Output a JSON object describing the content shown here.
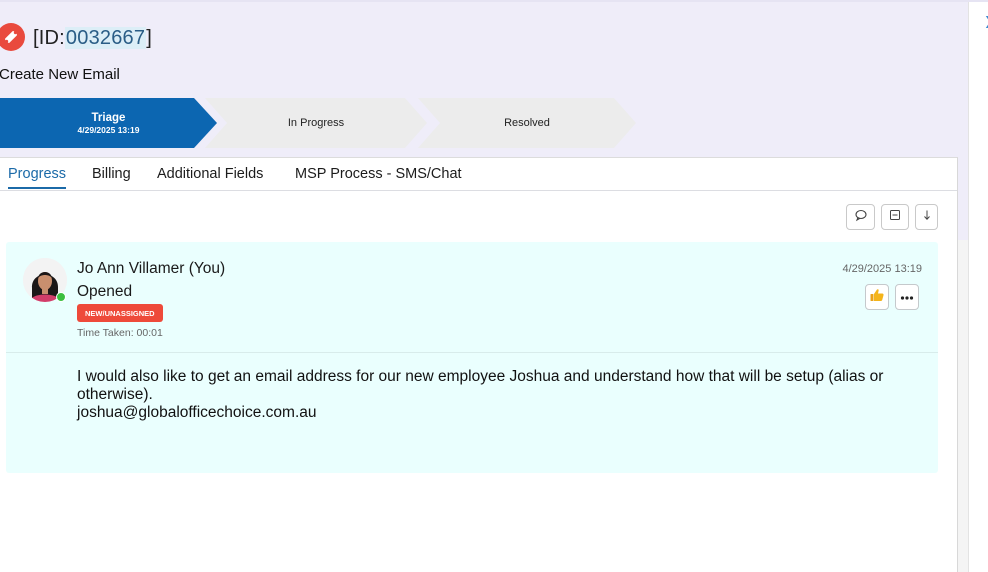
{
  "ticket": {
    "id_prefix": "[ID:",
    "id_number": "0032667",
    "id_suffix": "]",
    "title": "Create New Email"
  },
  "stages": [
    {
      "name": "Triage",
      "date": "4/29/2025 13:19",
      "active": true
    },
    {
      "name": "In Progress",
      "active": false
    },
    {
      "name": "Resolved",
      "active": false
    }
  ],
  "tabs": [
    {
      "label": "Progress",
      "active": true
    },
    {
      "label": "Billing",
      "active": false
    },
    {
      "label": "Additional Fields",
      "active": false
    },
    {
      "label": "MSP Process - SMS/Chat",
      "active": false
    }
  ],
  "toolbar": {
    "icons": [
      "comment-icon",
      "collapse-icon",
      "sort-down-icon"
    ]
  },
  "entry": {
    "author": "Jo Ann Villamer (You)",
    "status": "Opened",
    "badge": "NEW/UNASSIGNED",
    "time_taken": "Time Taken: 00:01",
    "timestamp": "4/29/2025 13:19",
    "body_line1": "I would also like to get an email address for our new employee Joshua and understand how that will be setup (alias or otherwise).",
    "body_line2": "joshua@globalofficechoice.com.au",
    "icons": [
      "thumbs-up-icon",
      "more-options-icon"
    ]
  },
  "colors": {
    "accent": "#0c66b1",
    "badge": "#ee4a3a",
    "card_bg": "#eafffe",
    "ticket_icon": "#e94a3e",
    "online": "#3bbf3f"
  },
  "sidebar": {
    "icon": "chevron-right-icon"
  }
}
